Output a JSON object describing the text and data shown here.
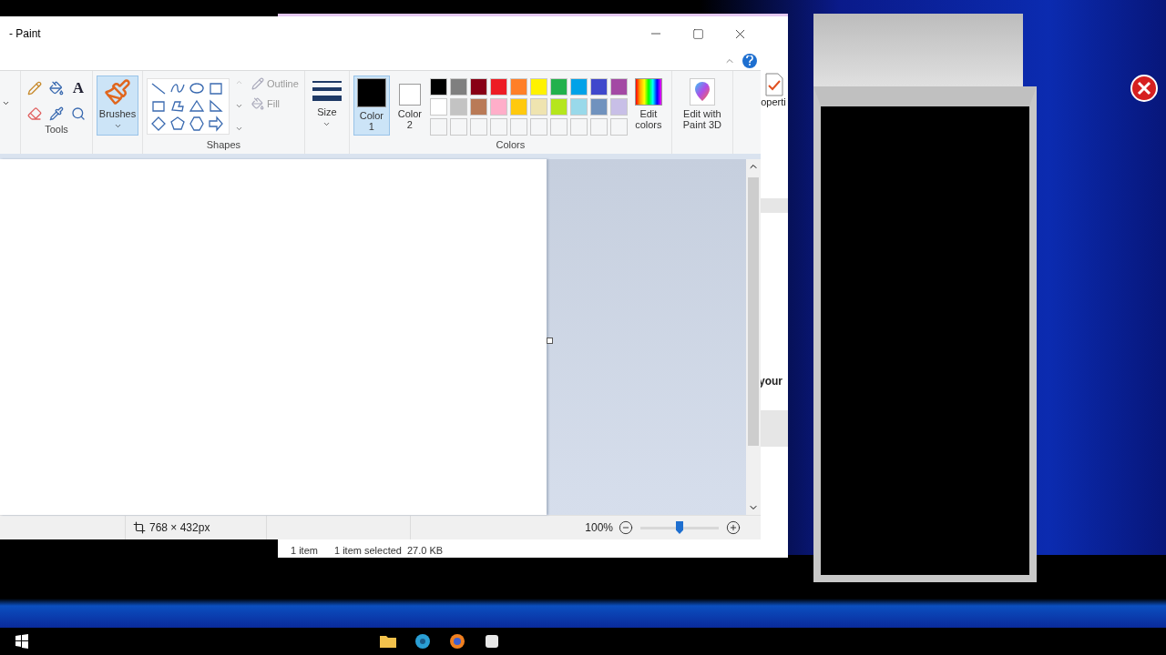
{
  "explorer_window": {
    "ribbon_label": "operti",
    "body_text": "your",
    "status_bar": {
      "items": "1 item",
      "selected": "1 item selected",
      "size": "27.0 KB"
    }
  },
  "paint_window": {
    "title": "- Paint",
    "ribbon": {
      "tools": {
        "label": "Tools",
        "text_glyph": "A"
      },
      "brushes": {
        "label": "Brushes",
        "selected": true
      },
      "shapes": {
        "label": "Shapes",
        "outline": "Outline",
        "fill": "Fill"
      },
      "size": {
        "label": "Size"
      },
      "color_slots": [
        {
          "label": "Color",
          "number": "1",
          "color": "#000000",
          "selected": true
        },
        {
          "label": "Color",
          "number": "2",
          "color": "#ffffff",
          "selected": false
        }
      ],
      "palette": [
        {
          "color": "#000000"
        },
        {
          "color": "#7f7f7f"
        },
        {
          "color": "#880015"
        },
        {
          "color": "#ed1c24"
        },
        {
          "color": "#ff7f27"
        },
        {
          "color": "#fff200"
        },
        {
          "color": "#22b14c"
        },
        {
          "color": "#00a2e8"
        },
        {
          "color": "#3f48cc"
        },
        {
          "color": "#a349a4"
        },
        {
          "color": "#ffffff"
        },
        {
          "color": "#c3c3c3"
        },
        {
          "color": "#b97a57"
        },
        {
          "color": "#ffaec9"
        },
        {
          "color": "#ffc90e"
        },
        {
          "color": "#efe4b0"
        },
        {
          "color": "#b5e61d"
        },
        {
          "color": "#99d9ea"
        },
        {
          "color": "#7092be"
        },
        {
          "color": "#c8bfe7"
        }
      ],
      "colors_label": "Colors",
      "edit_colors": "Edit colors",
      "edit_3d": "Edit with Paint 3D"
    },
    "status_bar": {
      "dimensions": "768 × 432px",
      "zoom": "100%",
      "level": 0.5
    }
  }
}
